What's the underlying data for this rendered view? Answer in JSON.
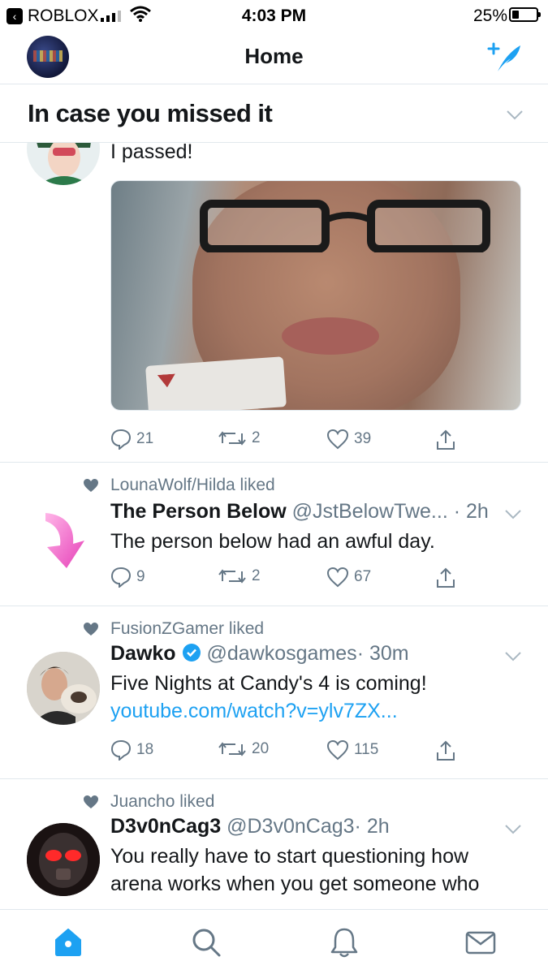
{
  "status_bar": {
    "back_app": "ROBLOX",
    "time": "4:03 PM",
    "battery": "25%",
    "battery_level": 0.25
  },
  "header": {
    "title": "Home"
  },
  "section": {
    "title": "In case you missed it"
  },
  "tweets": [
    {
      "text": "I passed!",
      "replies": "21",
      "retweets": "2",
      "likes": "39"
    },
    {
      "liked_by": "LounaWolf/Hilda liked",
      "name": "The Person Below",
      "handle": "@JstBelowTwe...",
      "time": "· 2h",
      "text": "The person below had an awful day.",
      "replies": "9",
      "retweets": "2",
      "likes": "67"
    },
    {
      "liked_by": "FusionZGamer liked",
      "name": "Dawko",
      "handle": "@dawkosgames",
      "time": "· 30m",
      "text": "Five Nights at Candy's 4 is coming!",
      "link": "youtube.com/watch?v=ylv7ZX...",
      "replies": "18",
      "retweets": "20",
      "likes": "115"
    },
    {
      "liked_by": "Juancho liked",
      "name": "D3v0nCag3",
      "handle": "@D3v0nCag3",
      "time": "· 2h",
      "text_line1": "You really have to start questioning how",
      "text_line2": "arena works when you get someone who"
    }
  ],
  "colors": {
    "accent": "#1da1f2",
    "muted": "#657786",
    "divider": "#e1e8ed"
  },
  "icons": [
    "compose-tweet-icon",
    "reply-icon",
    "retweet-icon",
    "like-icon",
    "share-icon",
    "home-icon",
    "search-icon",
    "notifications-icon",
    "messages-icon",
    "pink-arrow-icon",
    "verified-badge-icon"
  ]
}
